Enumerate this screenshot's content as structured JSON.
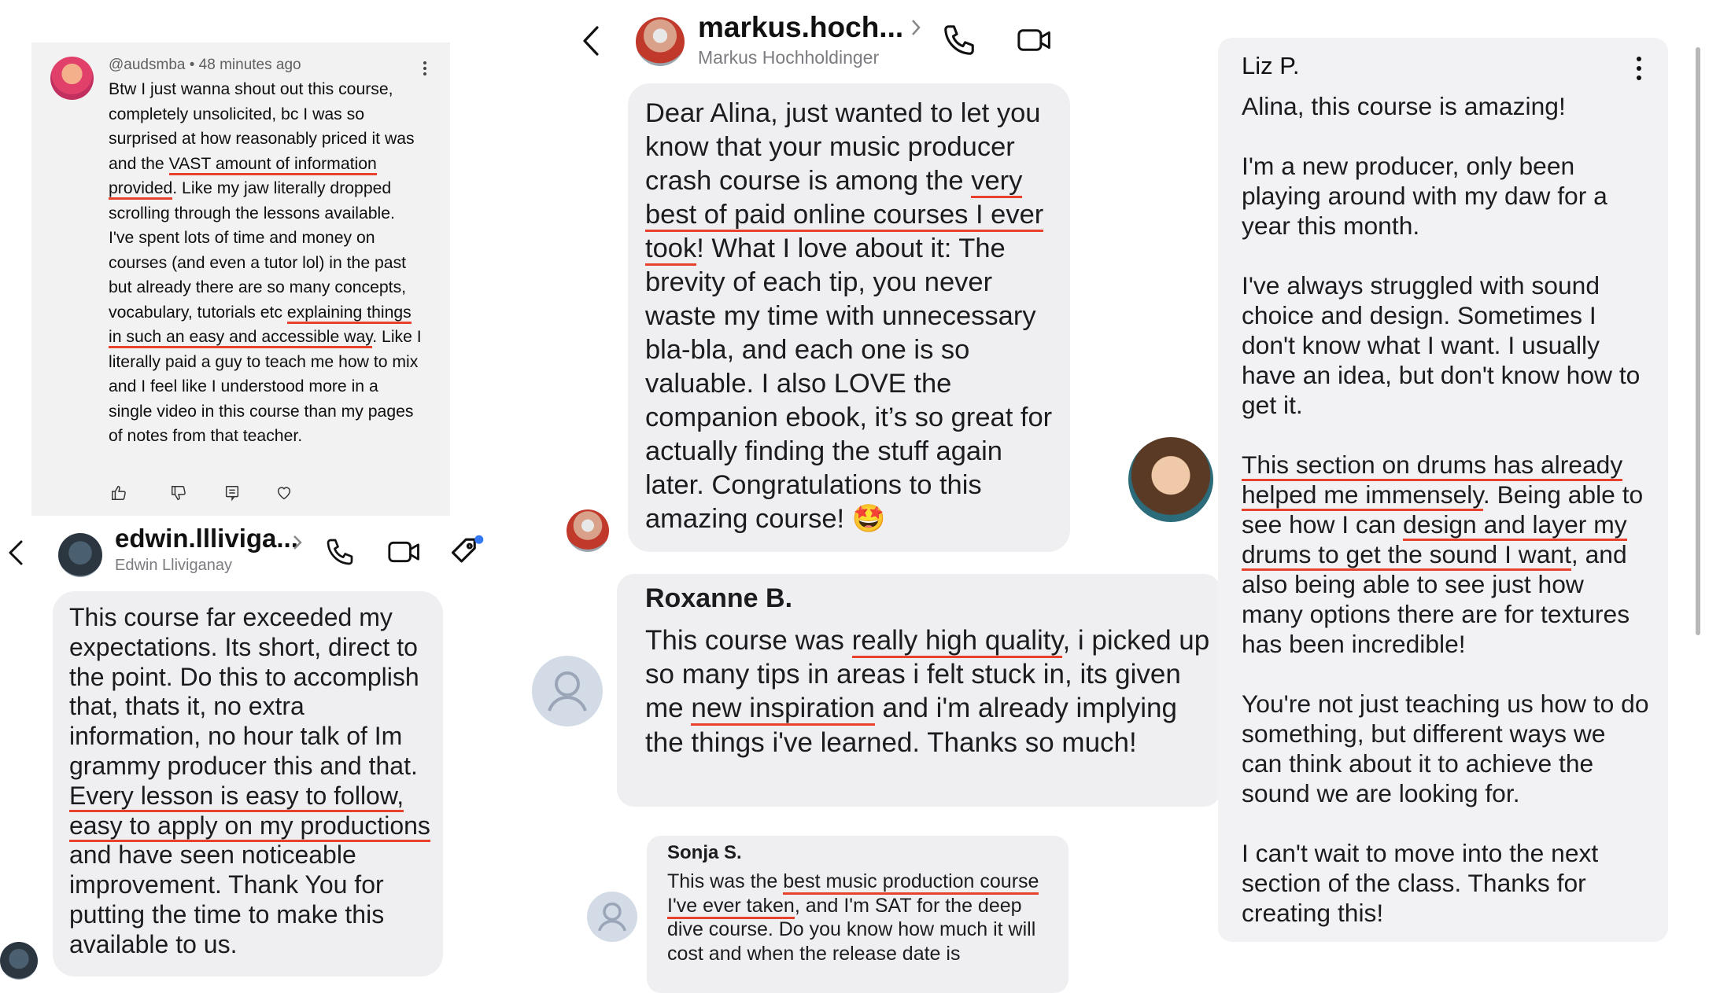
{
  "colors": {
    "underline": "#e8412c",
    "bubble": "#efeff1",
    "card": "#f2f2f2",
    "muted": "#7b7b80"
  },
  "youtube_comment": {
    "handle": "@audsmba",
    "sep": "•",
    "time": "48 minutes ago",
    "parts": [
      "Btw I just wanna shout out this course, completely unsolicited, bc I was so surprised at how reasonably priced it was and the ",
      "VAST amount of information provided",
      ". Like my jaw literally dropped scrolling through the lessons available. I've spent lots of time and money on courses (and even a tutor lol) in the past but already there are so many concepts, vocabulary, tutorials etc ",
      "explaining things in such an easy and accessible way",
      ". Like I literally paid a guy to teach me how to mix and I feel like I understood more in a single video in this course than my pages of notes from that teacher."
    ],
    "icons": [
      "thumbs-up-icon",
      "thumbs-down-icon",
      "reply-icon",
      "heart-icon"
    ]
  },
  "edwin_chat": {
    "name": "edwin.llliviga...",
    "subtitle": "Edwin Lliviganay",
    "parts": [
      "This course far exceeded my expectations. Its short, direct to the point. Do this to accomplish that, thats it, no extra information, no hour talk of Im grammy producer this and that. ",
      "Every lesson is easy to follow, easy to apply on my productions",
      " and have seen noticeable improvement. Thank You for putting the time to make this available to us."
    ]
  },
  "markus_chat": {
    "name": "markus.hoch...",
    "subtitle": "Markus Hochholdinger",
    "parts": [
      "Dear Alina, just wanted to let you know that your music producer crash course is among the ",
      "very best of paid online courses I ever took",
      "! What I love about it: The brevity of each tip, you never waste my time with unnecessary bla-bla, and each one is so valuable. I also LOVE the companion ebook, it’s so great for actually finding the stuff again later. Congratulations to this amazing course! 🤩"
    ]
  },
  "roxanne": {
    "name": "Roxanne B.",
    "parts": [
      "This course was ",
      "really high quality",
      ", i picked up so many tips in areas i felt stuck in, its given me ",
      "new inspiration",
      " and i'm already implying the things i've learned. Thanks so much!"
    ]
  },
  "sonja": {
    "name": "Sonja S.",
    "parts": [
      "This was the ",
      "best music production course I've ever taken",
      ", and I'm SAT for the deep dive course. Do you know how much it will cost and when the release date is"
    ]
  },
  "liz": {
    "name": "Liz P.",
    "parts": [
      "Alina, this course is amazing!\n\nI'm a new producer, only been playing around with my daw for a year this month.\n\nI've always struggled with sound choice and design. Sometimes I don't know what I want. I usually have an idea, but don't know how to get it.\n\n",
      "This section on drums has already helped me immensely",
      ". Being able to see how I can ",
      "design and layer my drums to get the sound I want",
      ", and also being able to see just how many options there are for textures has been incredible!\n\nYou're not just teaching us how to do something, but different ways we can think about it to achieve the sound we are looking for.\n\nI can't wait to move into the next section of the class. Thanks for creating this!"
    ]
  }
}
